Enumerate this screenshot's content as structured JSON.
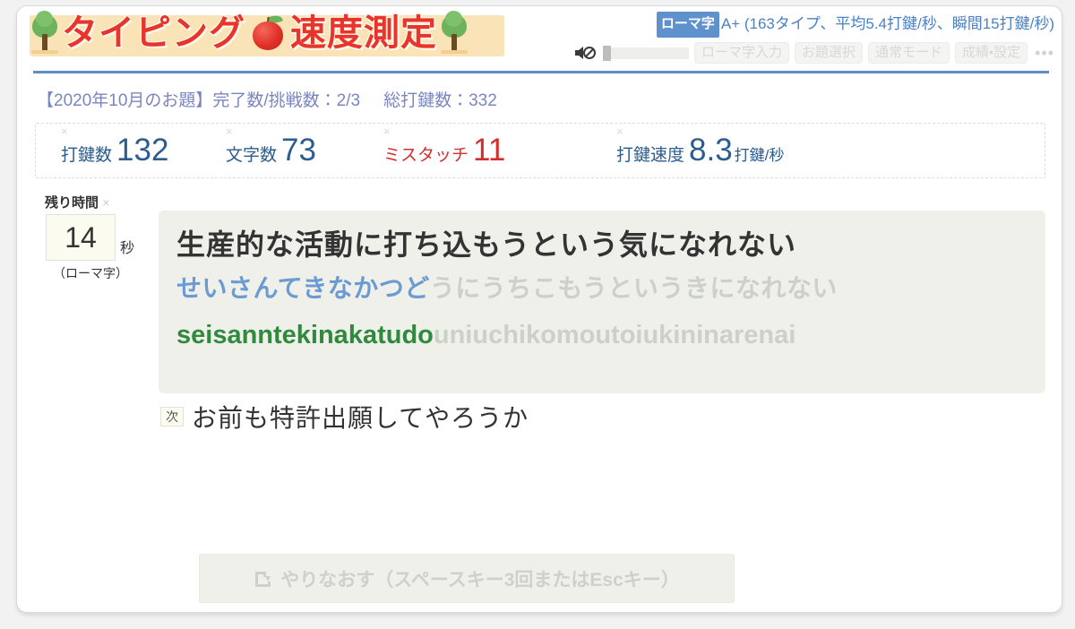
{
  "header": {
    "logo_text_1": "タイピング",
    "logo_text_2": "速度測定",
    "kana_mode_badge": "ローマ字",
    "rank_text": "A+ (163タイプ、平均5.4打鍵/秒、瞬間15打鍵/秒)",
    "toolbar": {
      "mute_icon": "speaker-muted-icon",
      "buttons": [
        {
          "label": "ローマ字入力",
          "name": "romaji-input-button"
        },
        {
          "label": "お題選択",
          "name": "topic-select-button"
        },
        {
          "label": "通常モード",
          "name": "normal-mode-button"
        },
        {
          "label": "成績・設定",
          "name": "score-settings-button"
        }
      ],
      "more_label": "•••"
    }
  },
  "info": {
    "topic": "【2020年10月のお題】完了数/挑戦数：2/3",
    "total_strokes": "総打鍵数：332"
  },
  "stats": {
    "close_mark": "×",
    "items": [
      {
        "label": "打鍵数",
        "value": "132",
        "unit": "",
        "color": "blue"
      },
      {
        "label": "文字数",
        "value": "73",
        "unit": "",
        "color": "blue"
      },
      {
        "label": "ミスタッチ",
        "value": "11",
        "unit": "",
        "color": "red"
      },
      {
        "label": "打鍵速度",
        "value": "8.3",
        "unit": "打鍵/秒",
        "color": "blue"
      }
    ]
  },
  "timer": {
    "heading": "残り時間",
    "close_mark": "×",
    "value": "14",
    "unit": "秒",
    "note": "（ローマ字）"
  },
  "typing": {
    "kanji": "生産的な活動に打ち込もうという気になれない",
    "kana_done": "せいさんてきなかつど",
    "kana_todo": "うにうちこもうというきになれない",
    "romaji_done": "seisanntekinakatudo",
    "romaji_todo": "uniuchikomoutoiukininarenai"
  },
  "next": {
    "badge": "次",
    "text": "お前も特許出願してやろうか"
  },
  "retry": {
    "icon": "restart-icon",
    "label": "やりなおす（スペースキー3回またはEscキー）"
  },
  "colors": {
    "accent_blue": "#5f92cc",
    "logo_red": "#e8352c",
    "stat_blue": "#2b5d8e",
    "stat_red": "#d32f2f",
    "kana_done": "#6b9bd2",
    "romaji_done": "#2f8a3e",
    "untyped_grey": "#cdcfc9",
    "panel_bg": "#eff0ea"
  }
}
